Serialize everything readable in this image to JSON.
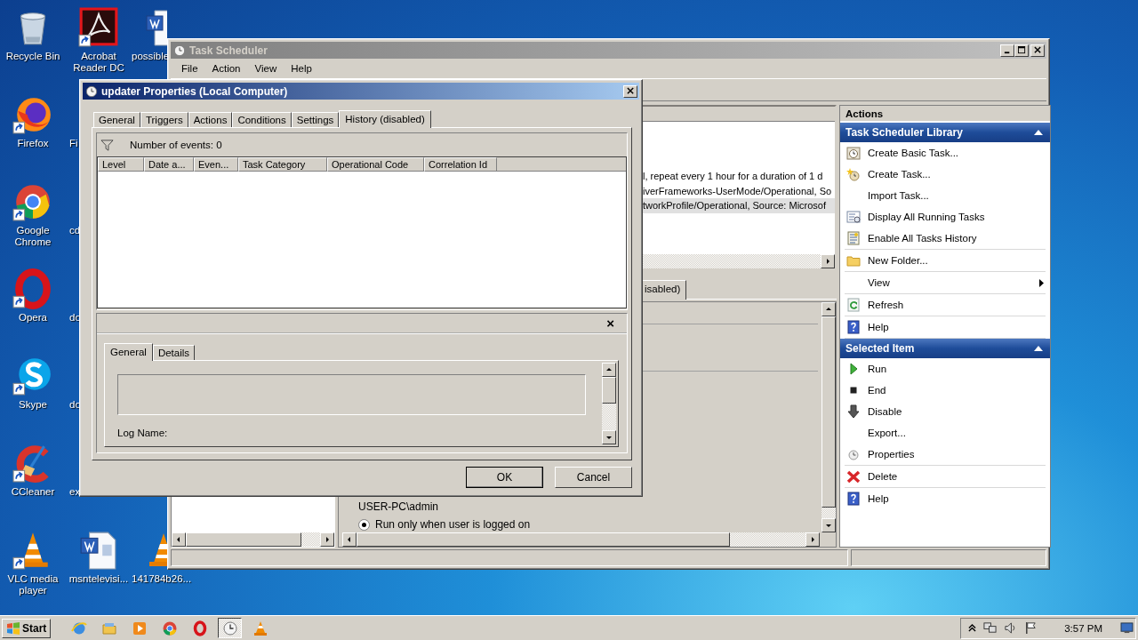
{
  "desktop_icons": [
    {
      "label": "Recycle Bin",
      "kind": "full",
      "shortcut": false
    },
    {
      "label": "Acrobat Reader DC",
      "kind": "full",
      "shortcut": true
    },
    {
      "label": "possible",
      "kind": "cut",
      "shortcut": false
    },
    {
      "label": "Firefox",
      "kind": "full",
      "shortcut": true
    },
    {
      "label": "Fi",
      "kind": "label-only"
    },
    {
      "label": "Google Chrome",
      "kind": "full",
      "shortcut": true
    },
    {
      "label": "cd",
      "kind": "label-only"
    },
    {
      "label": "Opera",
      "kind": "full",
      "shortcut": true
    },
    {
      "label": "do",
      "kind": "label-only"
    },
    {
      "label": "Skype",
      "kind": "full",
      "shortcut": true
    },
    {
      "label": "do",
      "kind": "label-only"
    },
    {
      "label": "CCleaner",
      "kind": "full",
      "shortcut": true
    },
    {
      "label": "ex",
      "kind": "label-only"
    },
    {
      "label": "VLC media player",
      "kind": "full",
      "shortcut": true
    },
    {
      "label": "msntelevisi...",
      "kind": "full",
      "shortcut": false
    },
    {
      "label": "141784b26...",
      "kind": "cut",
      "shortcut": false
    }
  ],
  "task_scheduler": {
    "title": "Task Scheduler",
    "menu": [
      "File",
      "Action",
      "View",
      "Help"
    ],
    "task_list": {
      "rows": [
        {
          "text": "l, repeat every 1 hour for a duration of 1 d",
          "selected": false
        },
        {
          "text": "iverFrameworks-UserMode/Operational, So",
          "selected": false
        },
        {
          "text": "tworkProfile/Operational, Source: Microsof",
          "selected": true
        }
      ]
    },
    "detail_tabs": [
      {
        "label": "isabled)",
        "selected": true
      }
    ],
    "detail": {
      "account": "USER-PC\\admin",
      "radio": {
        "label": "Run only when user is logged on",
        "selected": true
      }
    },
    "actions_pane": {
      "title": "Actions",
      "sections": [
        {
          "title": "Task Scheduler Library",
          "expanded": true,
          "groups": [
            {
              "items": [
                {
                  "label": "Create Basic Task...",
                  "submenu": false
                },
                {
                  "label": "Create Task...",
                  "submenu": false
                },
                {
                  "label": "Import Task...",
                  "submenu": false
                },
                {
                  "label": "Display All Running Tasks",
                  "submenu": false
                },
                {
                  "label": "Enable All Tasks History",
                  "submenu": false
                }
              ]
            },
            {
              "items": [
                {
                  "label": "New Folder...",
                  "submenu": false
                }
              ]
            },
            {
              "items": [
                {
                  "label": "View",
                  "submenu": true
                }
              ]
            },
            {
              "items": [
                {
                  "label": "Refresh",
                  "submenu": false
                }
              ]
            },
            {
              "items": [
                {
                  "label": "Help",
                  "submenu": false
                }
              ]
            }
          ]
        },
        {
          "title": "Selected Item",
          "expanded": true,
          "groups": [
            {
              "items": [
                {
                  "label": "Run",
                  "submenu": false
                },
                {
                  "label": "End",
                  "submenu": false
                },
                {
                  "label": "Disable",
                  "submenu": false
                },
                {
                  "label": "Export...",
                  "submenu": false
                },
                {
                  "label": "Properties",
                  "submenu": false
                }
              ]
            },
            {
              "items": [
                {
                  "label": "Delete",
                  "submenu": false
                }
              ]
            },
            {
              "items": [
                {
                  "label": "Help",
                  "submenu": false
                }
              ]
            }
          ]
        }
      ]
    }
  },
  "dialog": {
    "title": "updater Properties (Local Computer)",
    "tabs": [
      {
        "label": "General",
        "selected": false
      },
      {
        "label": "Triggers",
        "selected": false
      },
      {
        "label": "Actions",
        "selected": false
      },
      {
        "label": "Conditions",
        "selected": false
      },
      {
        "label": "Settings",
        "selected": false
      },
      {
        "label": "History (disabled)",
        "selected": true
      }
    ],
    "events_count": "Number of events: 0",
    "columns": [
      "Level",
      "Date a...",
      "Even...",
      "Task Category",
      "Operational Code",
      "Correlation Id"
    ],
    "close_glyph": "×",
    "detail_tabs": [
      {
        "label": "General",
        "selected": true
      },
      {
        "label": "Details",
        "selected": false
      }
    ],
    "log_name_label": "Log Name:",
    "buttons": [
      {
        "label": "OK",
        "default": true
      },
      {
        "label": "Cancel",
        "default": false
      }
    ]
  },
  "taskbar": {
    "start": "Start",
    "pinned": [
      {
        "selected": false
      },
      {
        "selected": false
      },
      {
        "selected": false
      },
      {
        "selected": false
      },
      {
        "selected": false
      },
      {
        "selected": true
      },
      {
        "selected": false
      }
    ],
    "clock": "3:57 PM"
  }
}
